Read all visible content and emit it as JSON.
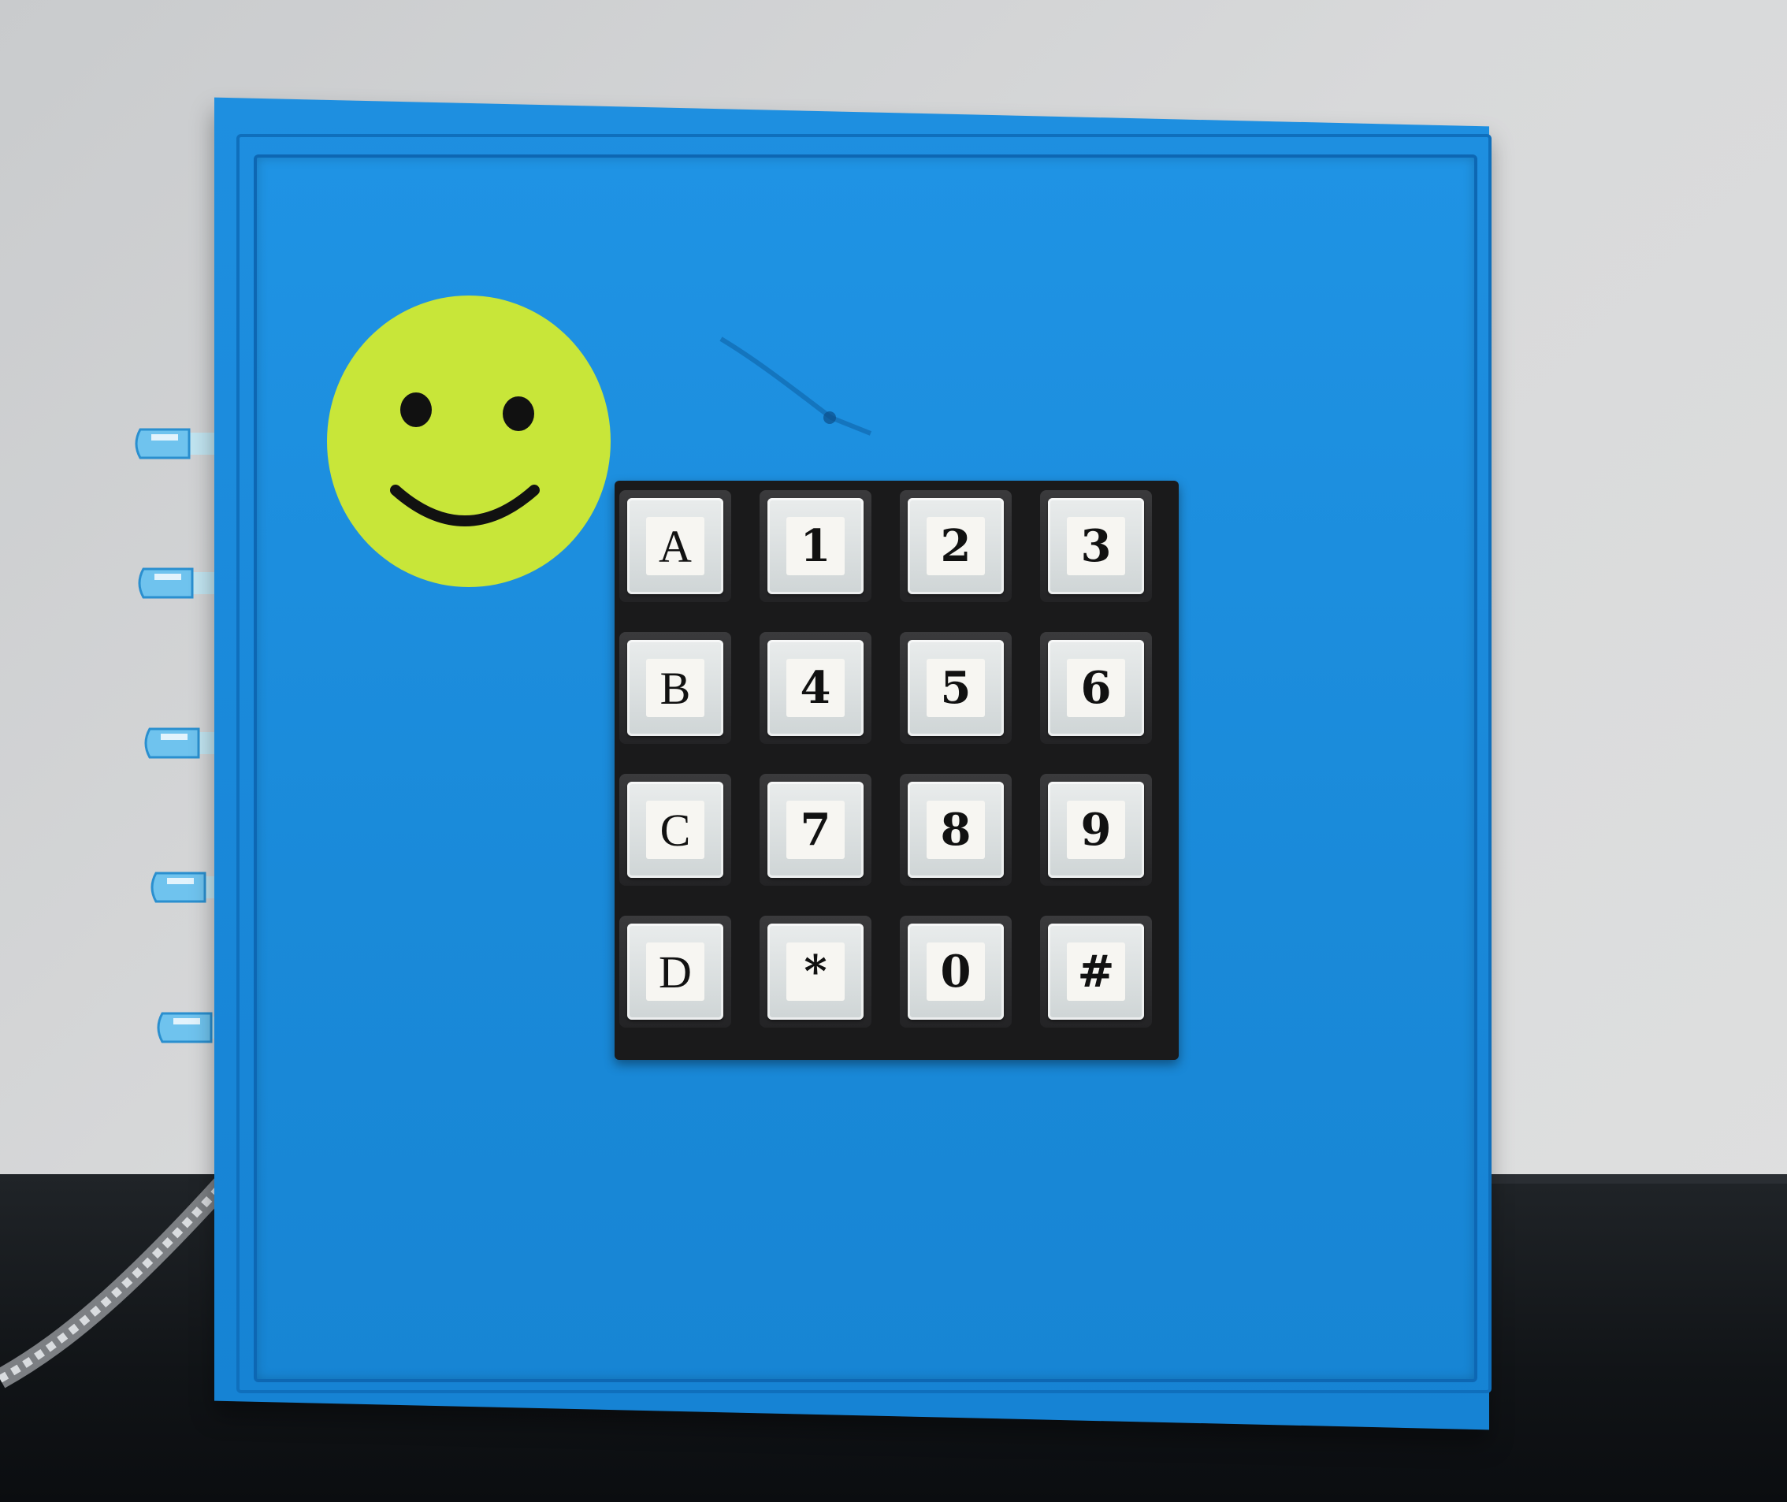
{
  "keypad": {
    "rows": [
      [
        "A",
        "1",
        "2",
        "3"
      ],
      [
        "B",
        "4",
        "5",
        "6"
      ],
      [
        "C",
        "7",
        "8",
        "9"
      ],
      [
        "D",
        "*",
        "0",
        "#"
      ]
    ]
  },
  "colors": {
    "enclosure": "#1a8ad9",
    "smiley": "#c8e639",
    "keypad_body": "#1a1a1b",
    "wall": "#d6d7d8",
    "table": "#14181c"
  },
  "icons": {
    "smiley": "smiley-face-sticker",
    "leds": "clear-led"
  },
  "led_count": 5
}
